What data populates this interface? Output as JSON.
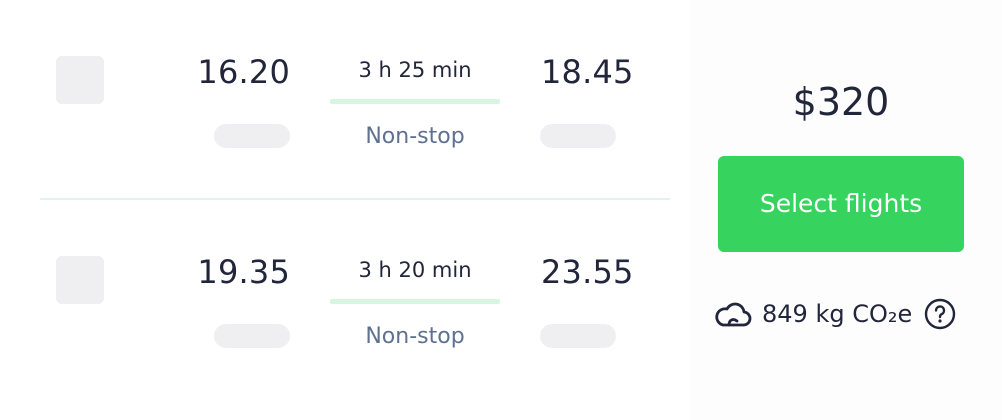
{
  "legs": [
    {
      "departure_time": "16.20",
      "arrival_time": "18.45",
      "duration": "3 h 25 min",
      "stops": "Non-stop"
    },
    {
      "departure_time": "19.35",
      "arrival_time": "23.55",
      "duration": "3 h 20 min",
      "stops": "Non-stop"
    }
  ],
  "price": "$320",
  "select_button_label": "Select flights",
  "emissions": {
    "text": "849 kg CO₂e",
    "icon": "cloud-icon",
    "help_icon": "question-icon"
  },
  "colors": {
    "accent_green": "#36d35e",
    "route_line": "#d7f5e1",
    "stops_text": "#5e7191",
    "placeholder_gray": "#efeff1"
  }
}
